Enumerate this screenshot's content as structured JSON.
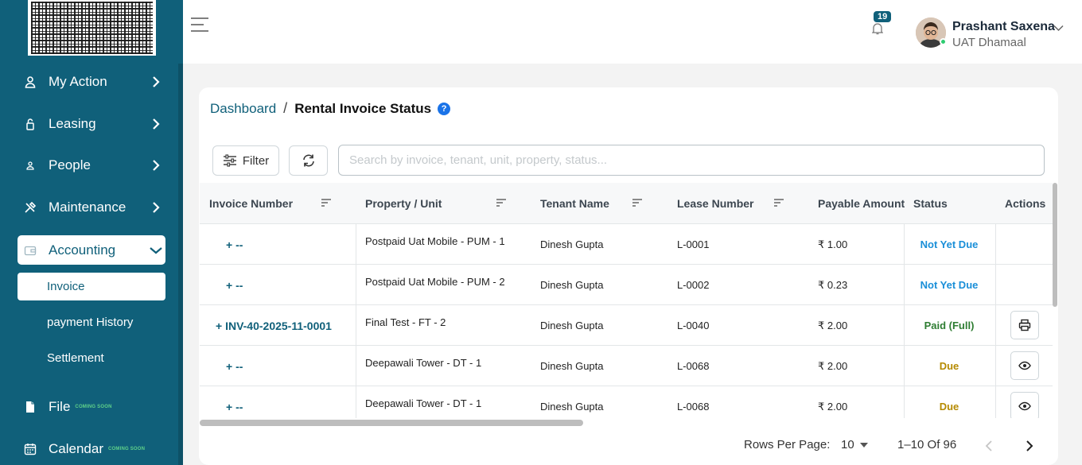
{
  "sidebar": {
    "items": [
      {
        "label": "My Action",
        "icon": "user-action-icon"
      },
      {
        "label": "Leasing",
        "icon": "lock-icon"
      },
      {
        "label": "People",
        "icon": "person-icon"
      },
      {
        "label": "Maintenance",
        "icon": "tools-icon"
      },
      {
        "label": "Accounting",
        "icon": "wallet-icon"
      }
    ],
    "accounting_sub": [
      "Invoice",
      "payment History",
      "Settlement"
    ],
    "file": {
      "label": "File",
      "tag": "COMING SOON"
    },
    "calendar": {
      "label": "Calendar",
      "tag": "COMING SOON"
    }
  },
  "header": {
    "notification_count": "19",
    "user_name": "Prashant Saxena",
    "user_org": "UAT Dhamaal"
  },
  "breadcrumb": {
    "root": "Dashboard",
    "sep": "/",
    "current": "Rental Invoice Status",
    "help": "?"
  },
  "toolbar": {
    "filter_label": "Filter",
    "search_placeholder": "Search by invoice, tenant, unit, property, status..."
  },
  "table": {
    "columns": [
      "Invoice Number",
      "Property / Unit",
      "Tenant Name",
      "Lease Number",
      "Payable Amount",
      "Status",
      "Actions"
    ],
    "rows": [
      {
        "invoice": "+ --",
        "property": "Postpaid Uat Mobile - PUM - 1",
        "tenant": "Dinesh Gupta",
        "lease": "L-0001",
        "amount": "₹ 1.00",
        "status": "Not Yet Due",
        "action": ""
      },
      {
        "invoice": "+ --",
        "property": "Postpaid Uat Mobile - PUM - 2",
        "tenant": "Dinesh Gupta",
        "lease": "L-0002",
        "amount": "₹ 0.23",
        "status": "Not Yet Due",
        "action": ""
      },
      {
        "invoice": "+ INV-40-2025-11-0001",
        "property": "Final Test - FT - 2",
        "tenant": "Dinesh Gupta",
        "lease": "L-0040",
        "amount": "₹ 2.00",
        "status": "Paid (Full)",
        "action": "print-icon"
      },
      {
        "invoice": "+ --",
        "property": "Deepawali Tower - DT - 1",
        "tenant": "Dinesh Gupta",
        "lease": "L-0068",
        "amount": "₹ 2.00",
        "status": "Due",
        "action": "eye-icon"
      },
      {
        "invoice": "+ --",
        "property": "Deepawali Tower - DT - 1",
        "tenant": "Dinesh Gupta",
        "lease": "L-0068",
        "amount": "₹ 2.00",
        "status": "Due",
        "action": "eye-icon"
      }
    ]
  },
  "status_colors": {
    "Not Yet Due": "#1a8fd8",
    "Paid (Full)": "#2e7d32",
    "Due": "#b58a00"
  },
  "pagination": {
    "rows_per_page_label": "Rows Per Page:",
    "rows_per_page": "10",
    "range": "1–10 Of 96"
  },
  "colors": {
    "brand": "#10607a"
  }
}
